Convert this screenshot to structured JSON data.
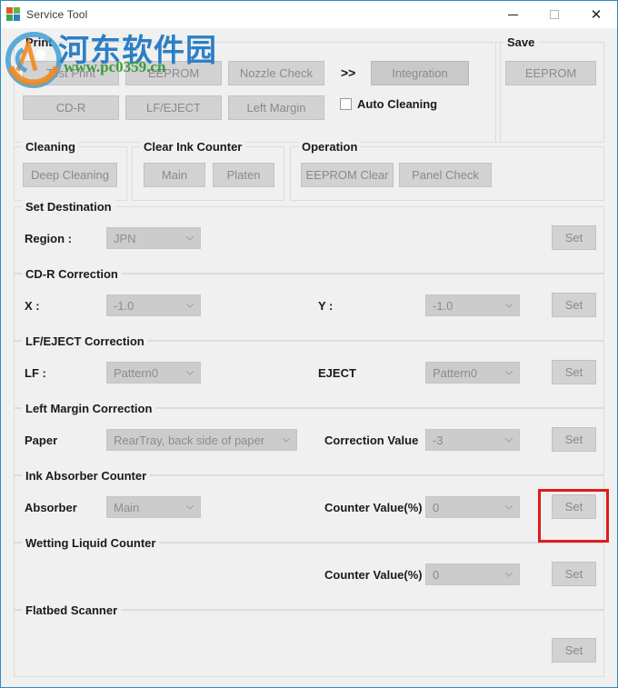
{
  "window": {
    "title": "Service Tool",
    "icon": "app-icon",
    "minimize_label": "─",
    "maximize_label": "□",
    "close_label": "×",
    "border_color": "#2e8bc0"
  },
  "watermark": {
    "chinese": "河东软件园",
    "url": "www.pc0359.cn",
    "chinese_color": "#2c7fc6",
    "url_color": "#3a9c3a"
  },
  "print": {
    "legend": "Print",
    "buttons": [
      {
        "label": "Test Print"
      },
      {
        "label": "EEPROM"
      },
      {
        "label": "Nozzle Check"
      },
      {
        "label": "CD-R"
      },
      {
        "label": "LF/EJECT"
      },
      {
        "label": "Left Margin"
      }
    ],
    "arrows": ">>",
    "integration_label": "Integration",
    "auto_cleaning_label": "Auto Cleaning",
    "auto_cleaning_checked": false
  },
  "save": {
    "legend": "Save",
    "eeprom_label": "EEPROM"
  },
  "cleaning": {
    "legend": "Cleaning",
    "deep_cleaning_label": "Deep Cleaning"
  },
  "clear_ink_counter": {
    "legend": "Clear Ink Counter",
    "main_label": "Main",
    "platen_label": "Platen"
  },
  "operation": {
    "legend": "Operation",
    "eeprom_clear_label": "EEPROM Clear",
    "panel_check_label": "Panel Check"
  },
  "set_destination": {
    "legend": "Set Destination",
    "region_label": "Region :",
    "region_value": "JPN",
    "set_label": "Set"
  },
  "cdr_correction": {
    "legend": "CD-R Correction",
    "x_label": "X :",
    "x_value": "-1.0",
    "y_label": "Y :",
    "y_value": "-1.0",
    "set_label": "Set"
  },
  "lf_eject_correction": {
    "legend": "LF/EJECT Correction",
    "lf_label": "LF :",
    "lf_value": "Pattern0",
    "eject_label": "EJECT",
    "eject_value": "Pattern0",
    "set_label": "Set"
  },
  "left_margin_correction": {
    "legend": "Left Margin Correction",
    "paper_label": "Paper",
    "paper_value": "RearTray, back side of paper",
    "correction_value_label": "Correction Value",
    "correction_value": "-3",
    "set_label": "Set"
  },
  "ink_absorber_counter": {
    "legend": "Ink Absorber Counter",
    "absorber_label": "Absorber",
    "absorber_value": "Main",
    "counter_value_label": "Counter Value(%)",
    "counter_value": "0",
    "set_label": "Set",
    "highlight_color": "#e01b1b"
  },
  "wetting_liquid_counter": {
    "legend": "Wetting Liquid Counter",
    "counter_value_label": "Counter Value(%)",
    "counter_value": "0",
    "set_label": "Set"
  },
  "flatbed_scanner": {
    "legend": "Flatbed Scanner",
    "set_label": "Set"
  }
}
